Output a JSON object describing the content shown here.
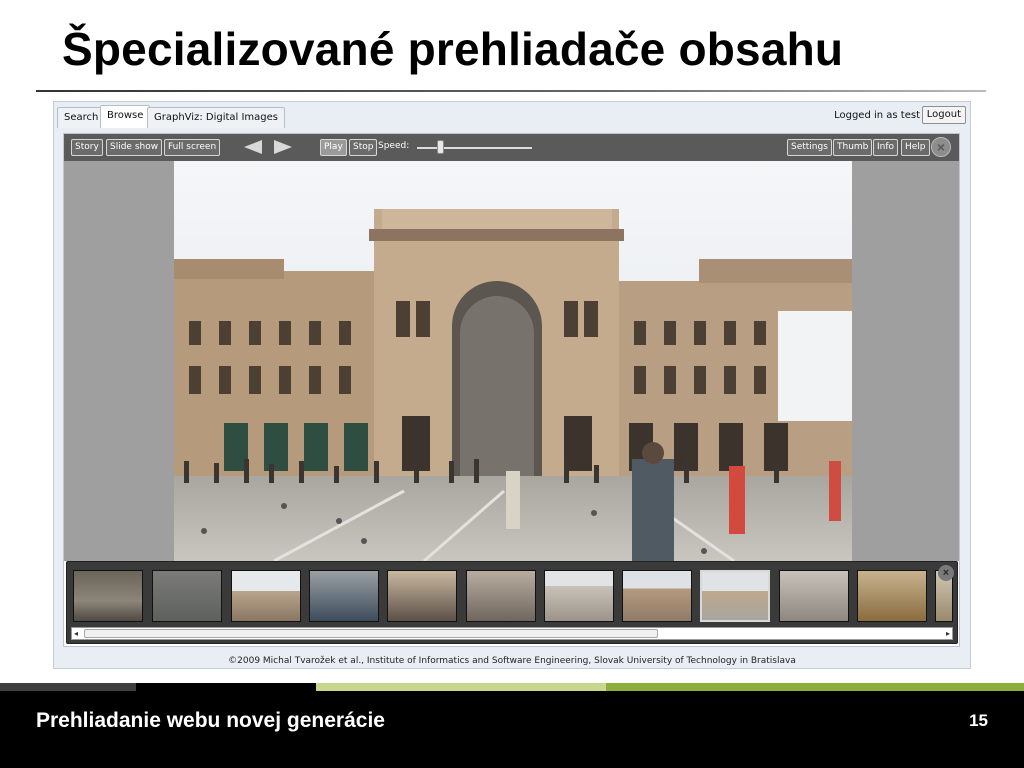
{
  "slide": {
    "title": "Špecializované prehliadače obsahu",
    "footer_text": "Prehliadanie webu novej generácie",
    "page_number": "15"
  },
  "app": {
    "tabs": [
      {
        "label": "Search"
      },
      {
        "label": "Browse"
      },
      {
        "label": "GraphViz: Digital Images"
      }
    ],
    "active_tab": "Browse",
    "login_status": "Logged in as test",
    "logout_label": "Logout",
    "toolbar": {
      "story": "Story",
      "slide_show": "Slide show",
      "full_screen": "Full screen",
      "play": "Play",
      "stop": "Stop",
      "speed_label": "Speed:",
      "speed_value": 0.2,
      "settings": "Settings",
      "thumb": "Thumb",
      "info": "Info",
      "help": "Help"
    },
    "filmstrip": {
      "thumbnail_count": 11,
      "selected_index": 8,
      "scroll_position": 0
    },
    "copyright": "©2009 Michal Tvarožek et al., Institute of Informatics and Software Engineering, Slovak University of Technology in Bratislava"
  },
  "colors": {
    "footer_bg": "#000000",
    "band_dark_gray": "#3f3f3f",
    "band_light_gray": "#a6a6a6",
    "band_olive": "#8cae3a",
    "band_light_olive": "#c7d78e",
    "toolbar_bg": "#5a5a5a"
  }
}
